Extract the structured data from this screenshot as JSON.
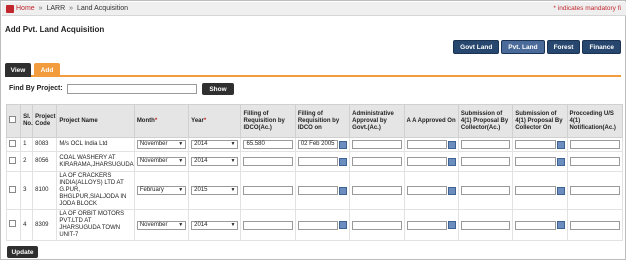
{
  "breadcrumb": {
    "home": "Home",
    "larr": "LARR",
    "current": "Land Acquisition",
    "sep": "»"
  },
  "mandatory_note": "indicates mandatory fi",
  "page_title": "Add Pvt. Land Acquisition",
  "top_buttons": [
    "Govt Land",
    "Pvt. Land",
    "Forest",
    "Finance"
  ],
  "tabs": {
    "view": "View",
    "add": "Add"
  },
  "find": {
    "label": "Find By Project:",
    "value": "",
    "button": "Show"
  },
  "table": {
    "headers": {
      "sl": "Sl. No.",
      "code": "Project Code",
      "name": "Project Name",
      "month": "Month",
      "year": "Year",
      "filling_ac": "Filling of Requisition by IDCO(Ac.)",
      "filling_on": "Filling of Requisition by IDCO on",
      "admin": "Administrative Approval by Govt.(Ac.)",
      "aa_on": "A A Approved On",
      "sub_ac": "Submission of 4(1) Proposal By Collector(Ac.)",
      "sub_on": "Submission of 4(1) Proposal By Collector On",
      "proc": "Procceding U/S 4(1) Notification(Ac.)"
    },
    "rows": [
      {
        "sl": "1",
        "code": "8083",
        "name": "M/s OCL India Ltd",
        "month": "November",
        "year": "2014",
        "filling_ac": "65.580",
        "filling_on": "02 Feb 2005"
      },
      {
        "sl": "2",
        "code": "8056",
        "name": "COAL WASHERY AT KIRARAMA,JHARSUGUDA",
        "month": "November",
        "year": "2014",
        "filling_ac": "",
        "filling_on": ""
      },
      {
        "sl": "3",
        "code": "8100",
        "name": "LA OF CRACKERS INDIA(ALLOYS) LTD AT G.PUR, BHGLPUR,SIALJODA IN JODA BLOCK",
        "month": "February",
        "year": "2015",
        "filling_ac": "",
        "filling_on": ""
      },
      {
        "sl": "4",
        "code": "8309",
        "name": "LA OF ORBIT MOTORS PVT.LTD AT JHARSUGUDA TOWN UNIT-7",
        "month": "November",
        "year": "2014",
        "filling_ac": "",
        "filling_on": ""
      }
    ]
  },
  "update_button": "Update"
}
